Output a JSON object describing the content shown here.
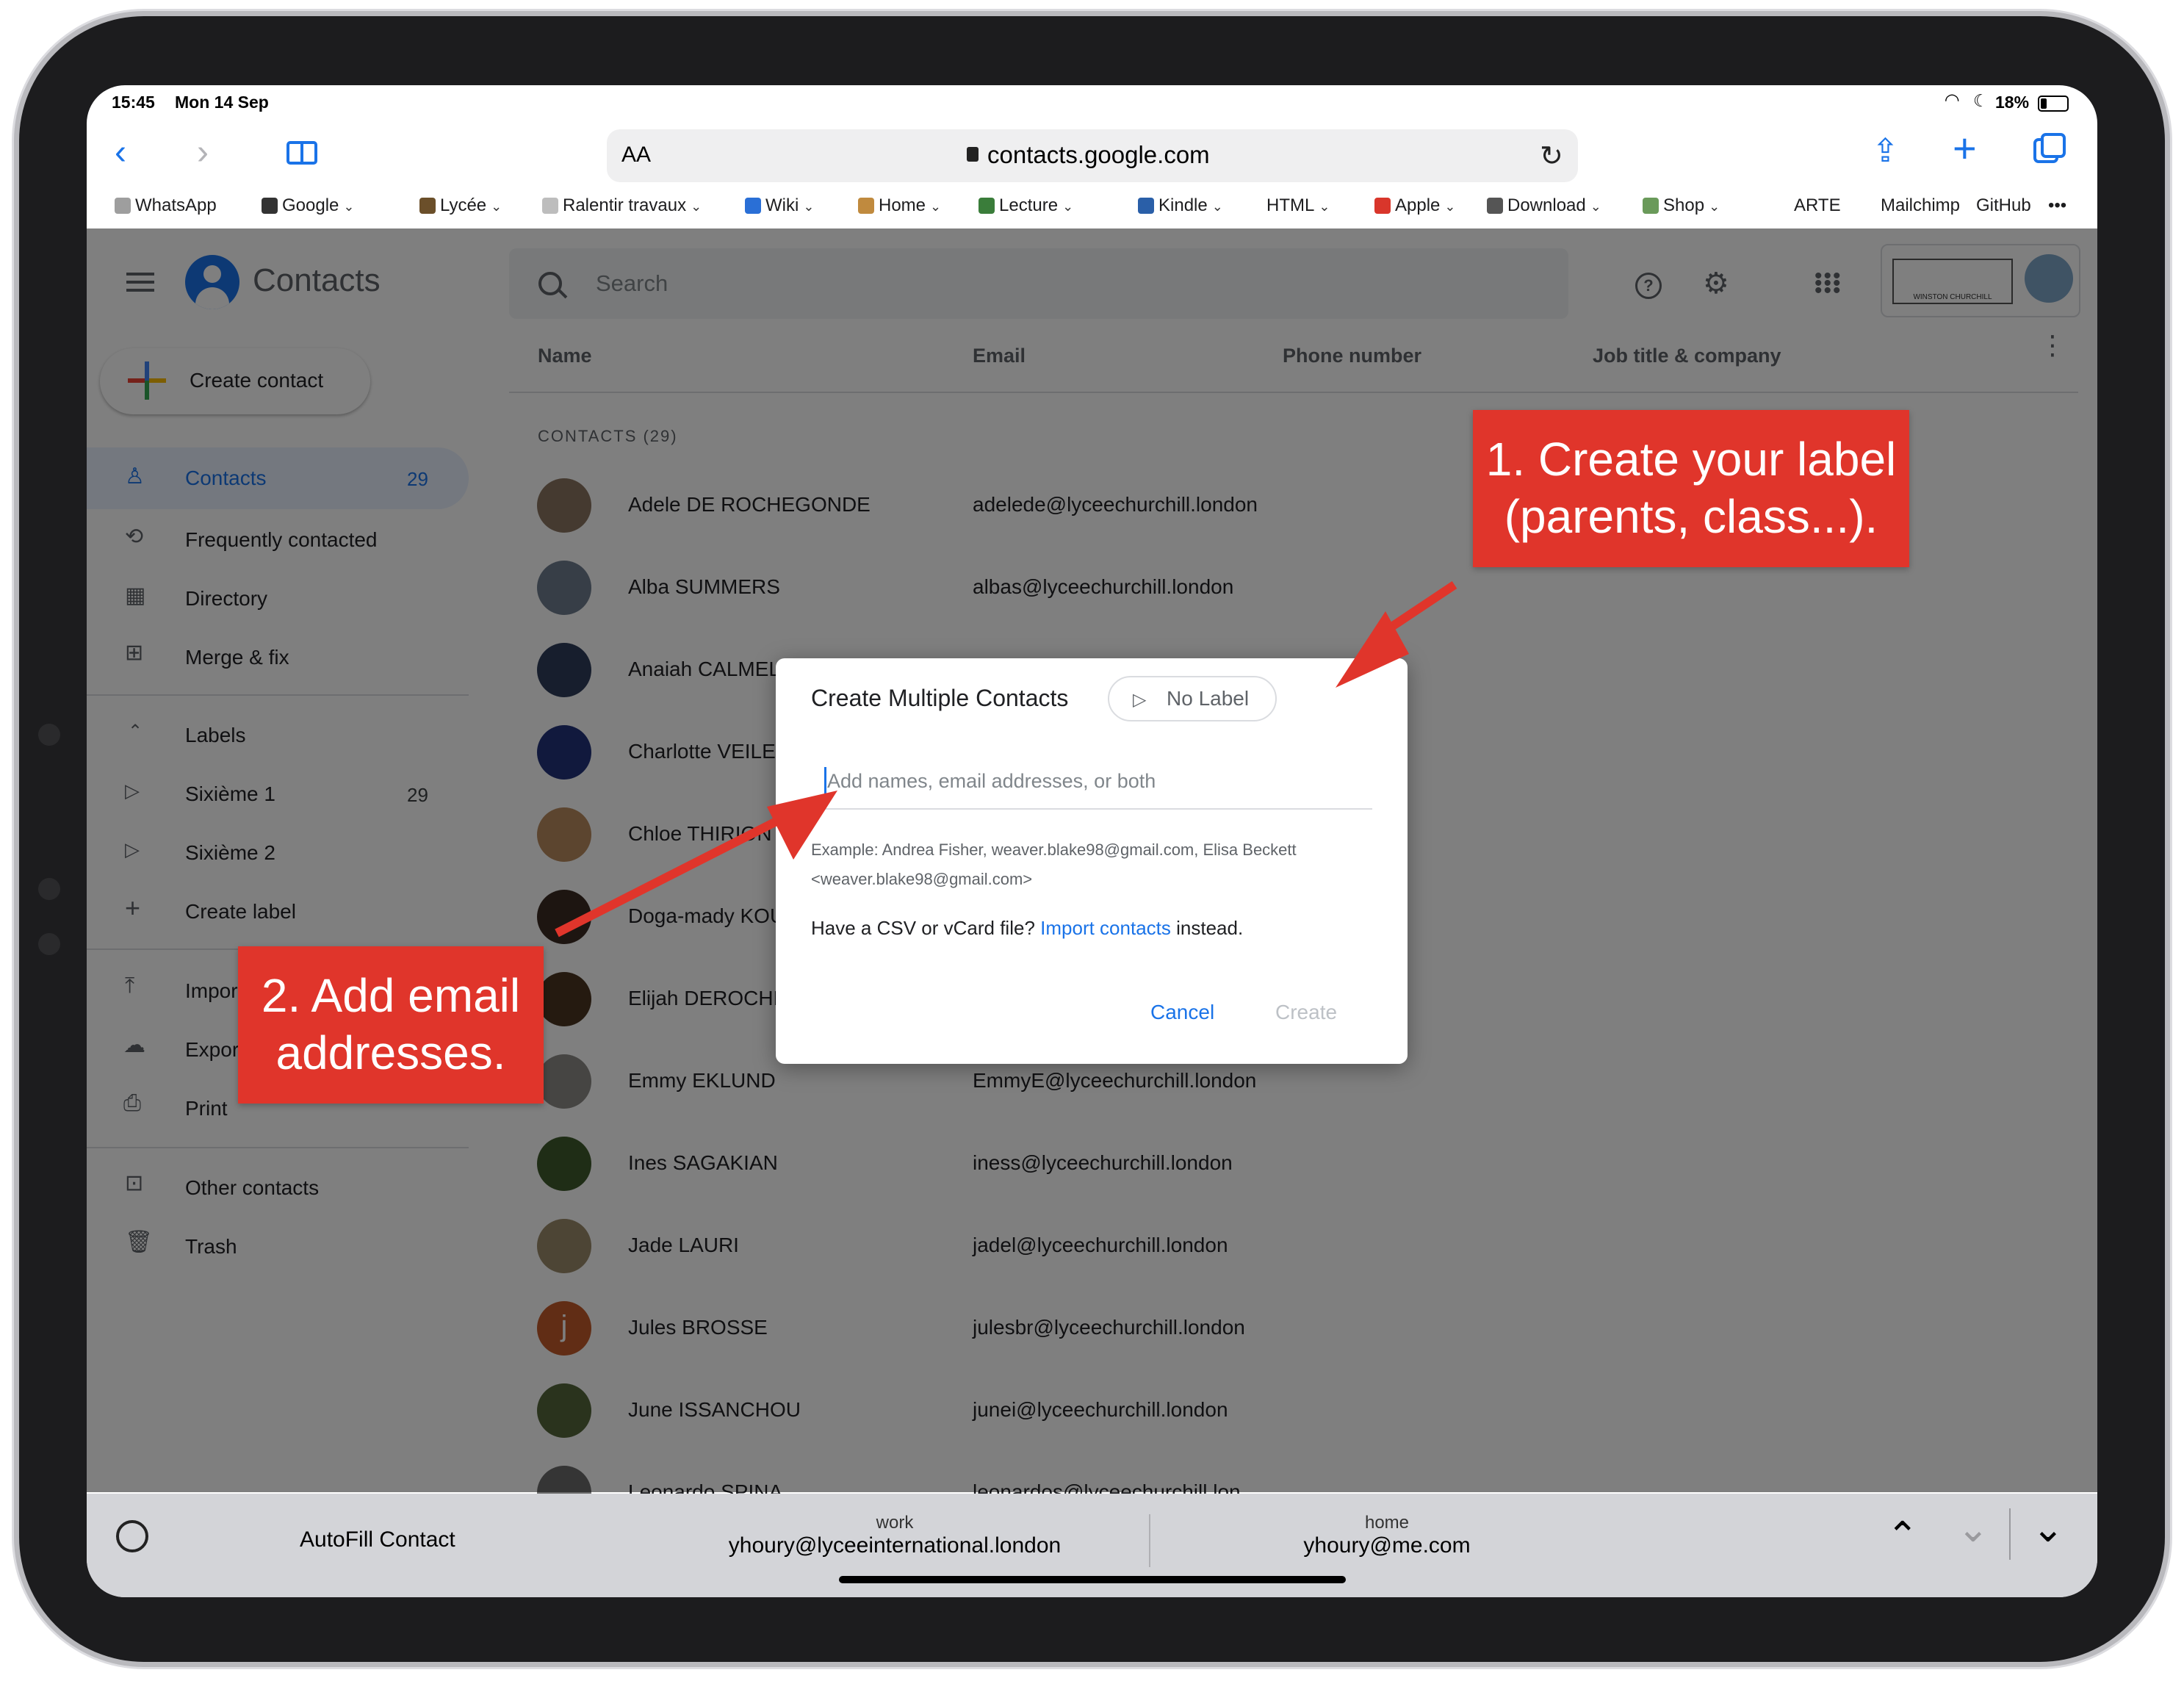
{
  "status_bar": {
    "time": "15:45",
    "date": "Mon 14 Sep",
    "battery": "18%"
  },
  "browser": {
    "text_size_label": "AA",
    "url": "contacts.google.com",
    "favorites": [
      {
        "label": "WhatsApp",
        "menu": false
      },
      {
        "label": "Google",
        "menu": true
      },
      {
        "label": "Lycée",
        "menu": true
      },
      {
        "label": "Ralentir travaux",
        "menu": true
      },
      {
        "label": "Wiki",
        "menu": true
      },
      {
        "label": "Home",
        "menu": true
      },
      {
        "label": "Lecture",
        "menu": true
      },
      {
        "label": "Kindle",
        "menu": true
      },
      {
        "label": "HTML",
        "menu": true
      },
      {
        "label": "Apple",
        "menu": true
      },
      {
        "label": "Download",
        "menu": true
      },
      {
        "label": "Shop",
        "menu": true
      },
      {
        "label": "ARTE",
        "menu": false
      },
      {
        "label": "Mailchimp",
        "menu": false
      },
      {
        "label": "GitHub",
        "menu": false
      }
    ],
    "more_label": "•••"
  },
  "app": {
    "title": "Contacts",
    "search_placeholder": "Search",
    "account_logo_text": "WINSTON CHURCHILL",
    "create_contact_label": "Create contact",
    "nav": [
      {
        "label": "Contacts",
        "count": "29",
        "icon": "person-icon"
      },
      {
        "label": "Frequently contacted",
        "count": "",
        "icon": "history-icon"
      },
      {
        "label": "Directory",
        "count": "",
        "icon": "building-icon"
      },
      {
        "label": "Merge & fix",
        "count": "",
        "icon": "merge-icon"
      }
    ],
    "labels_heading": "Labels",
    "labels": [
      {
        "label": "Sixième 1",
        "count": "29"
      },
      {
        "label": "Sixième 2",
        "count": ""
      }
    ],
    "create_label": "Create label",
    "import_label": "Import",
    "export_label": "Export",
    "print_label": "Print",
    "other_contacts_label": "Other contacts",
    "trash_label": "Trash",
    "columns": {
      "name": "Name",
      "email": "Email",
      "phone": "Phone number",
      "job": "Job title & company"
    },
    "section_heading": "CONTACTS (29)",
    "contacts": [
      {
        "name": "Adele DE ROCHEGONDE",
        "email": "adelede@lyceechurchill.london",
        "avatar_color": "#8a7460"
      },
      {
        "name": "Alba SUMMERS",
        "email": "albas@lyceechurchill.london",
        "avatar_color": "#6f7d8f"
      },
      {
        "name": "Anaiah CALMELS",
        "email": "",
        "avatar_color": "#2f3d5a"
      },
      {
        "name": "Charlotte VEILEX",
        "email": "",
        "avatar_color": "#22337a"
      },
      {
        "name": "Chloe THIRION",
        "email": "",
        "avatar_color": "#b88a5e"
      },
      {
        "name": "Doga-mady KOUYATE",
        "email": "",
        "avatar_color": "#3b2a22"
      },
      {
        "name": "Elijah DEROCHE",
        "email": "",
        "avatar_color": "#4a3420"
      },
      {
        "name": "Emmy EKLUND",
        "email": "EmmyE@lyceechurchill.london",
        "avatar_color": "#8d8a86"
      },
      {
        "name": "Ines SAGAKIAN",
        "email": "iness@lyceechurchill.london",
        "avatar_color": "#3f5a2c"
      },
      {
        "name": "Jade LAURI",
        "email": "jadel@lyceechurchill.london",
        "avatar_color": "#9a8a6a"
      },
      {
        "name": "Jules BROSSE",
        "email": "julesbr@lyceechurchill.london",
        "avatar_color": "#c25a2a",
        "initial": "j"
      },
      {
        "name": "June ISSANCHOU",
        "email": "junei@lyceechurchill.london",
        "avatar_color": "#55663a"
      },
      {
        "name": "Leonardo SPINA",
        "email": "leonardos@lyceechurchill.lon",
        "avatar_color": "#6a6a6a"
      }
    ]
  },
  "dialog": {
    "title": "Create Multiple Contacts",
    "label_chip": "No Label",
    "input_placeholder": "Add names, email addresses, or both",
    "example_line1": "Example: Andrea Fisher, weaver.blake98@gmail.com, Elisa Beckett",
    "example_line2": "<weaver.blake98@gmail.com>",
    "import_prefix": "Have a CSV or vCard file?",
    "import_link": "Import contacts",
    "import_suffix": "instead.",
    "cancel": "Cancel",
    "create": "Create"
  },
  "callouts": {
    "step1_line1": "1. Create your label",
    "step1_line2": "(parents, class...).",
    "step2_line1": "2. Add email",
    "step2_line2": "addresses."
  },
  "autofill": {
    "label": "AutoFill Contact",
    "option1_type": "work",
    "option1_value": "yhoury@lyceeinternational.london",
    "option2_type": "home",
    "option2_value": "yhoury@me.com"
  },
  "colors": {
    "accent": "#1a73e8",
    "callout": "#e0352b",
    "selected_nav": "#e8f0fe"
  }
}
